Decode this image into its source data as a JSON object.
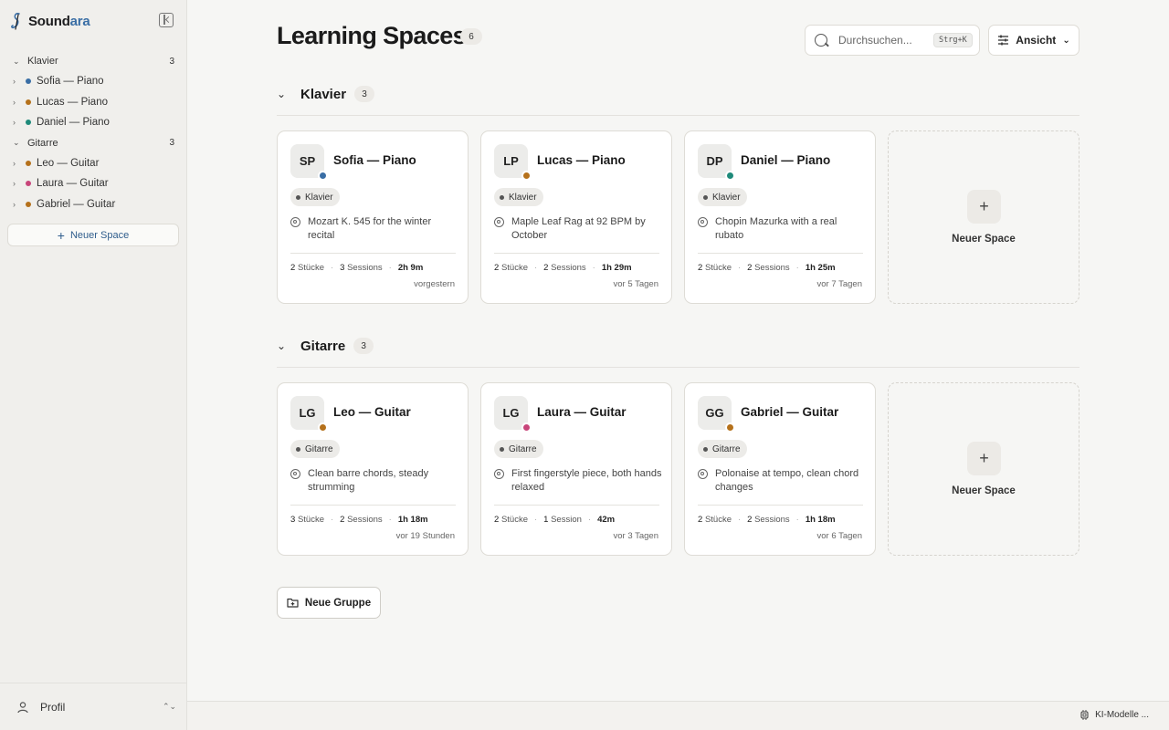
{
  "brand": {
    "name_main": "Sound",
    "name_accent": "ara",
    "accent_color": "#3a6ea5"
  },
  "sidebar": {
    "groups": [
      {
        "label": "Klavier",
        "count": "3",
        "items": [
          {
            "label": "Sofia — Piano",
            "dot": "#3a6ea5"
          },
          {
            "label": "Lucas — Piano",
            "dot": "#b5711b"
          },
          {
            "label": "Daniel — Piano",
            "dot": "#1f8a7a"
          }
        ]
      },
      {
        "label": "Gitarre",
        "count": "3",
        "items": [
          {
            "label": "Leo — Guitar",
            "dot": "#b5711b"
          },
          {
            "label": "Laura — Guitar",
            "dot": "#c8457a"
          },
          {
            "label": "Gabriel — Guitar",
            "dot": "#b5711b"
          }
        ]
      }
    ],
    "new_space": "Neuer Space",
    "profile": "Profil"
  },
  "header": {
    "title": "Learning Spaces",
    "count": "6",
    "search_placeholder": "Durchsuchen...",
    "shortcut": "Strg+K",
    "view": "Ansicht"
  },
  "sections": [
    {
      "name": "Klavier",
      "count": "3",
      "cards": [
        {
          "initials": "SP",
          "status": "#3a6ea5",
          "title": "Sofia — Piano",
          "tag": "Klavier",
          "goal": "Mozart K. 545 for the winter recital",
          "pieces_n": "2",
          "pieces_l": "Stücke",
          "sessions_n": "3",
          "sessions_l": "Sessions",
          "duration": "2h 9m",
          "when": "vorgestern"
        },
        {
          "initials": "LP",
          "status": "#b5711b",
          "title": "Lucas — Piano",
          "tag": "Klavier",
          "goal": "Maple Leaf Rag at 92 BPM by October",
          "pieces_n": "2",
          "pieces_l": "Stücke",
          "sessions_n": "2",
          "sessions_l": "Sessions",
          "duration": "1h 29m",
          "when": "vor 5 Tagen"
        },
        {
          "initials": "DP",
          "status": "#1f8a7a",
          "title": "Daniel — Piano",
          "tag": "Klavier",
          "goal": "Chopin Mazurka with a real rubato",
          "pieces_n": "2",
          "pieces_l": "Stücke",
          "sessions_n": "2",
          "sessions_l": "Sessions",
          "duration": "1h 25m",
          "when": "vor 7 Tagen"
        }
      ],
      "new_label": "Neuer Space"
    },
    {
      "name": "Gitarre",
      "count": "3",
      "cards": [
        {
          "initials": "LG",
          "status": "#b5711b",
          "title": "Leo — Guitar",
          "tag": "Gitarre",
          "goal": "Clean barre chords, steady strumming",
          "pieces_n": "3",
          "pieces_l": "Stücke",
          "sessions_n": "2",
          "sessions_l": "Sessions",
          "duration": "1h 18m",
          "when": "vor 19 Stunden"
        },
        {
          "initials": "LG",
          "status": "#c8457a",
          "title": "Laura — Guitar",
          "tag": "Gitarre",
          "goal": "First fingerstyle piece, both hands relaxed",
          "pieces_n": "2",
          "pieces_l": "Stücke",
          "sessions_n": "1",
          "sessions_l": "Session",
          "duration": "42m",
          "when": "vor 3 Tagen"
        },
        {
          "initials": "GG",
          "status": "#b5711b",
          "title": "Gabriel — Guitar",
          "tag": "Gitarre",
          "goal": "Polonaise at tempo, clean chord changes",
          "pieces_n": "2",
          "pieces_l": "Stücke",
          "sessions_n": "2",
          "sessions_l": "Sessions",
          "duration": "1h 18m",
          "when": "vor 6 Tagen"
        }
      ],
      "new_label": "Neuer Space"
    }
  ],
  "new_group": "Neue Gruppe",
  "footer": {
    "ki_models": "KI-Modelle ..."
  }
}
